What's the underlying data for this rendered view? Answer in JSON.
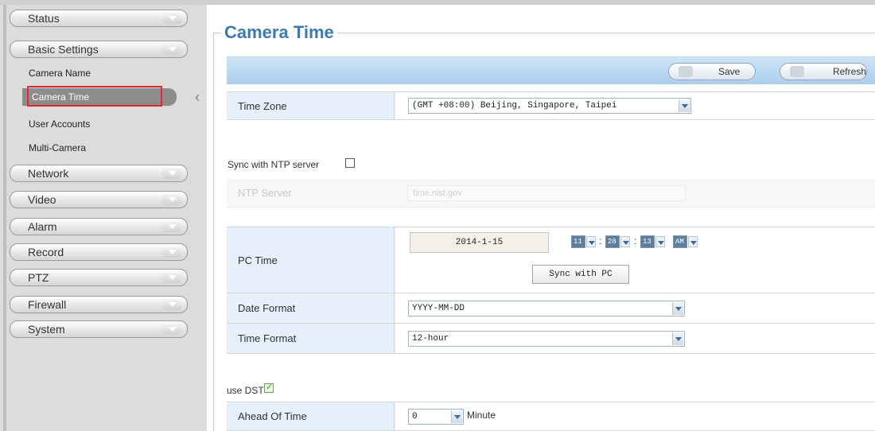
{
  "sidebar": {
    "menu": [
      {
        "label": "Status"
      },
      {
        "label": "Basic Settings"
      },
      {
        "label": "Network"
      },
      {
        "label": "Video"
      },
      {
        "label": "Alarm"
      },
      {
        "label": "Record"
      },
      {
        "label": "PTZ"
      },
      {
        "label": "Firewall"
      },
      {
        "label": "System"
      }
    ],
    "sub_items": [
      {
        "label": "Camera Name"
      },
      {
        "label": "Camera Time"
      },
      {
        "label": "User Accounts"
      },
      {
        "label": "Multi-Camera"
      }
    ],
    "active_sub": "Camera Time"
  },
  "page": {
    "title": "Camera Time"
  },
  "toolbar": {
    "save_label": "Save",
    "refresh_label": "Refresh"
  },
  "form": {
    "time_zone_label": "Time Zone",
    "time_zone_value": "(GMT +08:00) Beijing, Singapore, Taipei",
    "sync_ntp_label": "Sync with NTP server",
    "sync_ntp_checked": false,
    "ntp_server_label": "NTP Server",
    "ntp_server_value": "time.nist.gov",
    "pc_time_label": "PC Time",
    "pc_date": "2014-1-15",
    "pc_hour": "11",
    "pc_minute": "28",
    "pc_second": "13",
    "pc_ampm": "AM",
    "time_sep": ":",
    "sync_pc_label": "Sync with PC",
    "date_format_label": "Date Format",
    "date_format_value": "YYYY-MM-DD",
    "time_format_label": "Time Format",
    "time_format_value": "12-hour",
    "use_dst_label": "use DST",
    "use_dst_checked": true,
    "ahead_label": "Ahead Of Time",
    "ahead_value": "0",
    "ahead_unit": "Minute"
  },
  "colors": {
    "title": "#3b7ab8",
    "toolbar": "#a9cfee",
    "highlight_outline": "#e8262b"
  },
  "icons": {
    "menu_arrow": "chevron-down-icon",
    "save": "save-icon",
    "refresh": "refresh-icon"
  }
}
